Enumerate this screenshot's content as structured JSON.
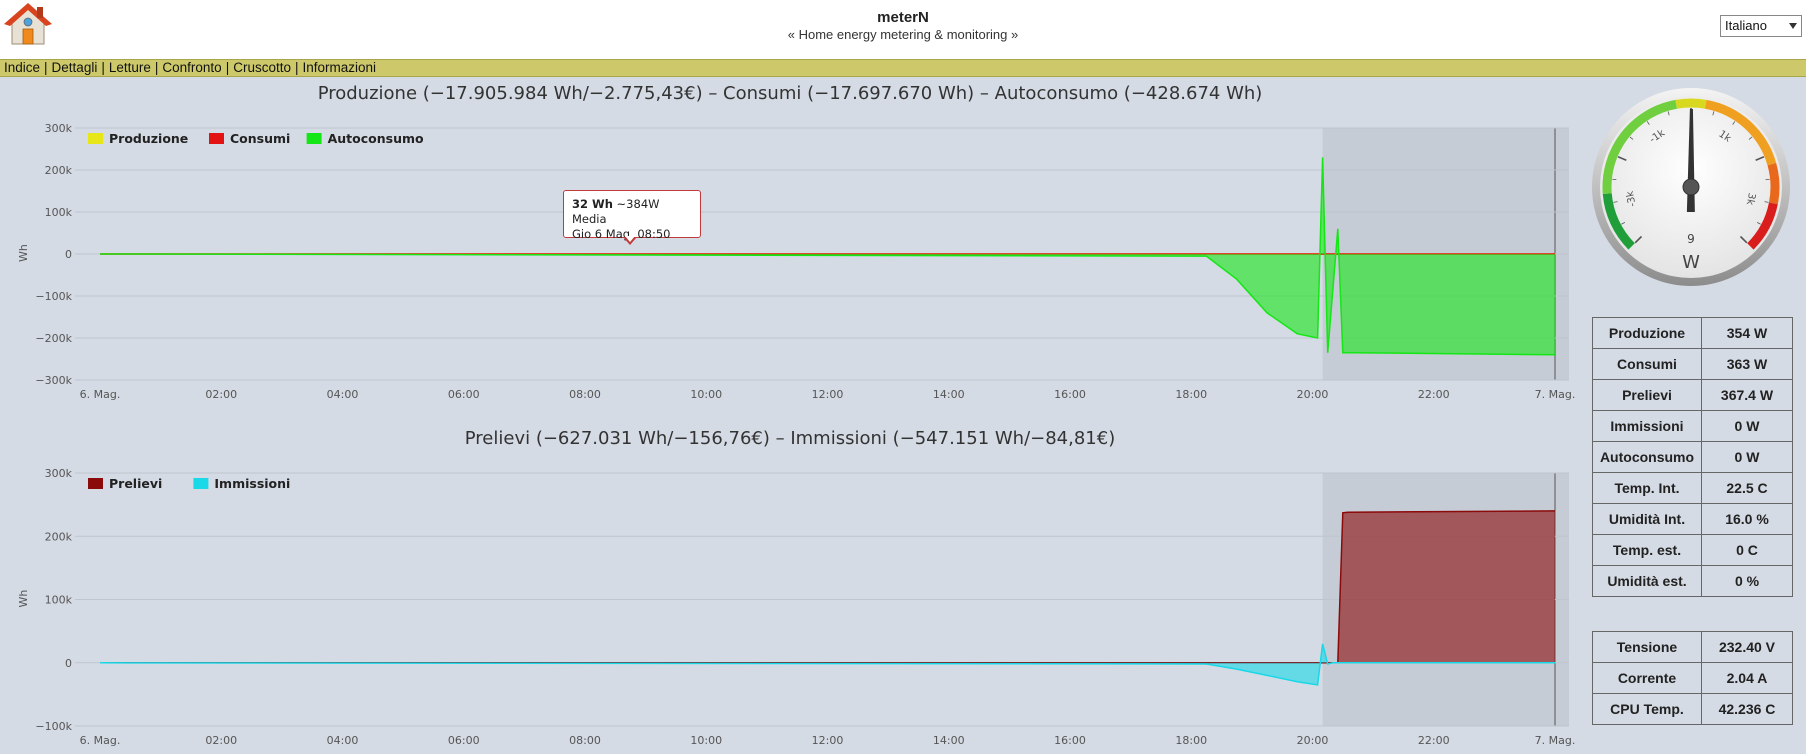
{
  "app": {
    "title": "meterN",
    "subtitle": "« Home energy metering & monitoring »"
  },
  "language": {
    "selected": "Italiano"
  },
  "menu": [
    "Indice",
    "Dettagli",
    "Letture",
    "Confronto",
    "Cruscotto",
    "Informazioni"
  ],
  "tooltip": {
    "value": "32 Wh",
    "detail": "~384W Media",
    "date": "Gio 6 Mag. 08:50"
  },
  "chart_data": [
    {
      "type": "area",
      "title": "Produzione (−17.905.984 Wh/−2.775,43€) – Consumi (−17.697.670 Wh) – Autoconsumo (−428.674 Wh)",
      "ylabel": "Wh",
      "ylim": [
        -300000,
        300000
      ],
      "y_ticks": [
        "300k",
        "200k",
        "100k",
        "0",
        "−100k",
        "−200k",
        "−300k"
      ],
      "x_ticks": [
        "6. Mag.",
        "02:00",
        "04:00",
        "06:00",
        "08:00",
        "10:00",
        "12:00",
        "14:00",
        "16:00",
        "18:00",
        "20:00",
        "22:00",
        "7. Mag."
      ],
      "legend": "top-left",
      "highlight_band": [
        "20:10",
        "24:00"
      ],
      "series": [
        {
          "name": "Produzione",
          "color": "#e6e619",
          "x": [
            "0:00",
            "24:00"
          ],
          "y": [
            0,
            0
          ]
        },
        {
          "name": "Consumi",
          "color": "#e41313",
          "x": [
            "0:00",
            "18:00",
            "20:00",
            "24:00"
          ],
          "y": [
            0,
            0,
            0,
            0
          ]
        },
        {
          "name": "Autoconsumo",
          "color": "#15e615",
          "x": [
            "0:00",
            "18:15",
            "18:45",
            "19:15",
            "19:45",
            "20:05",
            "20:10",
            "20:15",
            "20:25",
            "20:30",
            "20:35",
            "20:40",
            "24:00"
          ],
          "y": [
            0,
            -5000,
            -60000,
            -140000,
            -190000,
            -200000,
            230000,
            -235000,
            60000,
            -235000,
            -235000,
            -235000,
            -240000
          ]
        }
      ]
    },
    {
      "type": "area",
      "title": "Prelievi (−627.031 Wh/−156,76€) – Immissioni (−547.151 Wh/−84,81€)",
      "ylabel": "Wh",
      "ylim": [
        -100000,
        300000
      ],
      "y_ticks": [
        "300k",
        "200k",
        "100k",
        "0",
        "−100k"
      ],
      "x_ticks": [
        "6. Mag.",
        "02:00",
        "04:00",
        "06:00",
        "08:00",
        "10:00",
        "12:00",
        "14:00",
        "16:00",
        "18:00",
        "20:00",
        "22:00",
        "7. Mag."
      ],
      "legend": "top-left",
      "highlight_band": [
        "20:10",
        "24:00"
      ],
      "series": [
        {
          "name": "Prelievi",
          "color": "#8b0a0a",
          "x": [
            "0:00",
            "20:20",
            "20:25",
            "20:30",
            "20:35",
            "24:00"
          ],
          "y": [
            0,
            0,
            0,
            237000,
            238000,
            240000
          ]
        },
        {
          "name": "Immissioni",
          "color": "#19d8e8",
          "x": [
            "0:00",
            "18:15",
            "18:45",
            "19:15",
            "19:45",
            "20:05",
            "20:10",
            "20:15",
            "20:20",
            "24:00"
          ],
          "y": [
            0,
            -2000,
            -10000,
            -20000,
            -30000,
            -35000,
            30000,
            -2000,
            0,
            0
          ]
        }
      ]
    }
  ],
  "gauge": {
    "value": "9",
    "unit": "W",
    "labels": [
      "-3k",
      "-1k",
      "1k",
      "3k"
    ],
    "reading": 9,
    "min": -4000,
    "max": 4000
  },
  "stats_table_1": [
    {
      "label": "Produzione",
      "value": "354 W"
    },
    {
      "label": "Consumi",
      "value": "363 W"
    },
    {
      "label": "Prelievi",
      "value": "367.4 W"
    },
    {
      "label": "Immissioni",
      "value": "0 W"
    },
    {
      "label": "Autoconsumo",
      "value": "0 W"
    },
    {
      "label": "Temp. Int.",
      "value": "22.5 C"
    },
    {
      "label": "Umidità Int.",
      "value": "16.0 %"
    },
    {
      "label": "Temp. est.",
      "value": "0 C"
    },
    {
      "label": "Umidità est.",
      "value": "0 %"
    }
  ],
  "stats_table_2": [
    {
      "label": "Tensione",
      "value": "232.40 V"
    },
    {
      "label": "Corrente",
      "value": "2.04 A"
    },
    {
      "label": "CPU Temp.",
      "value": "42.236 C"
    }
  ]
}
